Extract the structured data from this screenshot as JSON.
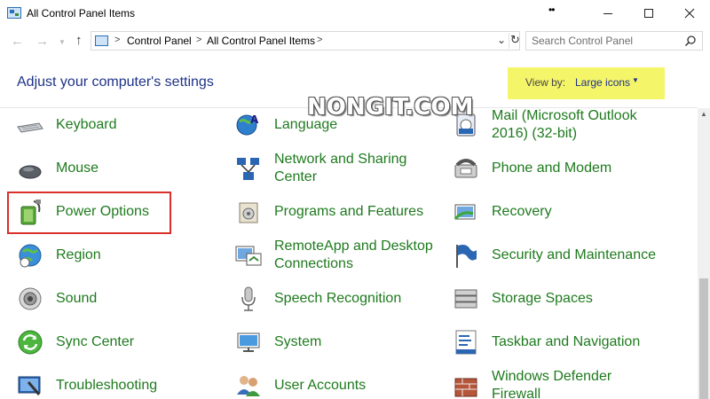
{
  "window": {
    "title": "All Control Panel Items",
    "extra_glyph": "••"
  },
  "address_bar": {
    "breadcrumbs": [
      "Control Panel",
      "All Control Panel Items"
    ],
    "separator": ">"
  },
  "search": {
    "placeholder": "Search Control Panel"
  },
  "header": {
    "heading": "Adjust your computer's settings",
    "view_by_label": "View by:",
    "view_by_value": "Large icons",
    "highlight_color": "#f5f56a"
  },
  "watermark": "NONGIT.COM",
  "items": {
    "col1": [
      {
        "label": "Keyboard",
        "icon": "keyboard-icon"
      },
      {
        "label": "Mouse",
        "icon": "mouse-icon"
      },
      {
        "label": "Power Options",
        "icon": "power-options-icon",
        "highlighted": true
      },
      {
        "label": "Region",
        "icon": "region-globe-icon"
      },
      {
        "label": "Sound",
        "icon": "speaker-icon"
      },
      {
        "label": "Sync Center",
        "icon": "sync-icon"
      },
      {
        "label": "Troubleshooting",
        "icon": "troubleshooting-icon"
      }
    ],
    "col2": [
      {
        "label": "Language",
        "icon": "language-globe-icon"
      },
      {
        "label_line1": "Network and Sharing",
        "label_line2": "Center",
        "icon": "network-icon"
      },
      {
        "label": "Programs and Features",
        "icon": "programs-icon"
      },
      {
        "label_line1": "RemoteApp and Desktop",
        "label_line2": "Connections",
        "icon": "remoteapp-icon"
      },
      {
        "label": "Speech Recognition",
        "icon": "microphone-icon"
      },
      {
        "label": "System",
        "icon": "system-monitor-icon"
      },
      {
        "label": "User Accounts",
        "icon": "users-icon"
      }
    ],
    "col3": [
      {
        "label_line1": "Mail (Microsoft Outlook",
        "label_line2": "2016) (32-bit)",
        "icon": "mail-icon"
      },
      {
        "label": "Phone and Modem",
        "icon": "phone-icon"
      },
      {
        "label": "Recovery",
        "icon": "recovery-icon"
      },
      {
        "label": "Security and Maintenance",
        "icon": "security-flag-icon"
      },
      {
        "label": "Storage Spaces",
        "icon": "storage-icon"
      },
      {
        "label": "Taskbar and Navigation",
        "icon": "taskbar-icon"
      },
      {
        "label_line1": "Windows Defender",
        "label_line2": "Firewall",
        "icon": "firewall-icon"
      }
    ]
  },
  "colors": {
    "item_text": "#1e7a1e",
    "heading_text": "#1e3287",
    "highlight_border": "#d9302b"
  }
}
